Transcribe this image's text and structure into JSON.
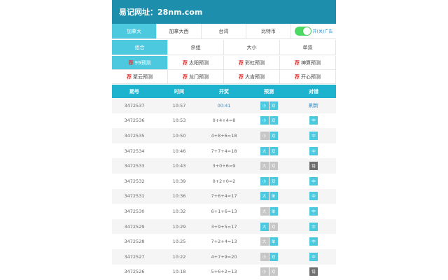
{
  "header": {
    "title": "易记网址：28nm.com"
  },
  "region_tabs": [
    "加拿大",
    "加拿大西",
    "台湾",
    "比特币"
  ],
  "region_active": 0,
  "toggle": {
    "label": "开(关)广告",
    "on": true
  },
  "mode_tabs": [
    "组合",
    "杀组",
    "大小",
    "单双"
  ],
  "mode_active": 0,
  "predictions": {
    "badge": "荐",
    "items": [
      "99预测",
      "太阳预测",
      "彩虹预测",
      "神算预测",
      "聚云预测",
      "龙门预测",
      "大吉预测",
      "开心预测"
    ],
    "active": 0
  },
  "table": {
    "headers": [
      "期号",
      "时间",
      "开奖",
      "预测",
      "对错"
    ],
    "rows": [
      {
        "id": "3472537",
        "time": "10:57",
        "result": "00:41",
        "pred": [
          "小",
          "双"
        ],
        "pred_colors": [
          "blue",
          "blue"
        ],
        "check": "刷新",
        "check_type": "link"
      },
      {
        "id": "3472536",
        "time": "10:53",
        "result": "0+4+4=8",
        "pred": [
          "小",
          "双"
        ],
        "pred_colors": [
          "blue",
          "blue"
        ],
        "check": "中",
        "check_type": "blue"
      },
      {
        "id": "3472535",
        "time": "10:50",
        "result": "4+8+6=18",
        "pred": [
          "小",
          "双"
        ],
        "pred_colors": [
          "grey",
          "blue"
        ],
        "check": "中",
        "check_type": "blue"
      },
      {
        "id": "3472534",
        "time": "10:46",
        "result": "7+7+4=18",
        "pred": [
          "大",
          "双"
        ],
        "pred_colors": [
          "blue",
          "blue"
        ],
        "check": "中",
        "check_type": "blue"
      },
      {
        "id": "3472533",
        "time": "10:43",
        "result": "3+0+6=9",
        "pred": [
          "大",
          "双"
        ],
        "pred_colors": [
          "grey",
          "grey"
        ],
        "check": "错",
        "check_type": "dark"
      },
      {
        "id": "3472532",
        "time": "10:39",
        "result": "0+2+0=2",
        "pred": [
          "小",
          "双"
        ],
        "pred_colors": [
          "blue",
          "blue"
        ],
        "check": "中",
        "check_type": "blue"
      },
      {
        "id": "3472531",
        "time": "10:36",
        "result": "7+6+4=17",
        "pred": [
          "大",
          "单"
        ],
        "pred_colors": [
          "blue",
          "blue"
        ],
        "check": "中",
        "check_type": "blue"
      },
      {
        "id": "3472530",
        "time": "10:32",
        "result": "6+1+6=13",
        "pred": [
          "大",
          "单"
        ],
        "pred_colors": [
          "grey",
          "blue"
        ],
        "check": "中",
        "check_type": "blue"
      },
      {
        "id": "3472529",
        "time": "10:29",
        "result": "3+9+5=17",
        "pred": [
          "大",
          "双"
        ],
        "pred_colors": [
          "blue",
          "grey"
        ],
        "check": "中",
        "check_type": "blue"
      },
      {
        "id": "3472528",
        "time": "10:25",
        "result": "7+2+4=13",
        "pred": [
          "大",
          "单"
        ],
        "pred_colors": [
          "grey",
          "blue"
        ],
        "check": "中",
        "check_type": "blue"
      },
      {
        "id": "3472527",
        "time": "10:22",
        "result": "4+7+9=20",
        "pred": [
          "小",
          "双"
        ],
        "pred_colors": [
          "grey",
          "blue"
        ],
        "check": "中",
        "check_type": "blue"
      },
      {
        "id": "3472526",
        "time": "10:18",
        "result": "5+6+2=13",
        "pred": [
          "小",
          "双"
        ],
        "pred_colors": [
          "grey",
          "grey"
        ],
        "check": "错",
        "check_type": "dark"
      }
    ]
  },
  "colors": {
    "header_bg": "#1d8fad",
    "accent": "#4cc9de",
    "table_head": "#1db3cf",
    "wrong": "#6e6e6e",
    "toggle_on": "#4cd964"
  }
}
